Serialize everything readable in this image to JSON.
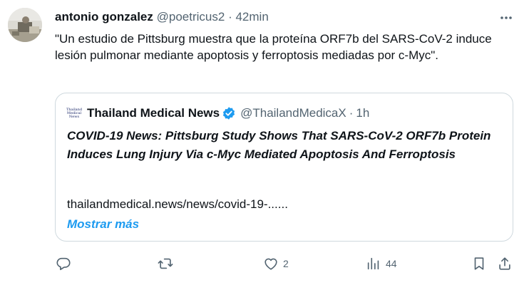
{
  "post": {
    "author_name": "antonio gonzalez",
    "author_handle": "@poetricus2",
    "separator": "·",
    "time": "42min",
    "text": "\"Un estudio de Pittsburg muestra que la proteína ORF7b del SARS-CoV-2 induce lesión pulmonar mediante apoptosis y ferroptosis mediadas por c-Myc\"."
  },
  "quote": {
    "logo_text_line1": "Thailand",
    "logo_text_line2": "Medical",
    "logo_text_line3": "News",
    "author_name": "Thailand Medical News",
    "author_handle": "@ThailandMedicaX",
    "separator": "·",
    "time": "1h",
    "headline": "COVID-19 News: Pittsburg Study Shows That SARS-CoV-2 ORF7b Protein Induces Lung Injury Via c-Myc Mediated Apoptosis And Ferroptosis",
    "url": "thailandmedical.news/news/covid-19-......",
    "show_more": "Mostrar más"
  },
  "actions": {
    "replies": "",
    "reposts": "",
    "likes": "2",
    "views": "44"
  },
  "icons": {
    "more": "more-horizontal-icon",
    "reply": "reply-icon",
    "repost": "repost-icon",
    "like": "heart-icon",
    "views": "views-icon",
    "bookmark": "bookmark-icon",
    "share": "share-icon",
    "verified": "verified-badge-icon"
  },
  "colors": {
    "accent": "#1d9bf0",
    "secondary_text": "#536471",
    "border": "#cfd9de"
  }
}
